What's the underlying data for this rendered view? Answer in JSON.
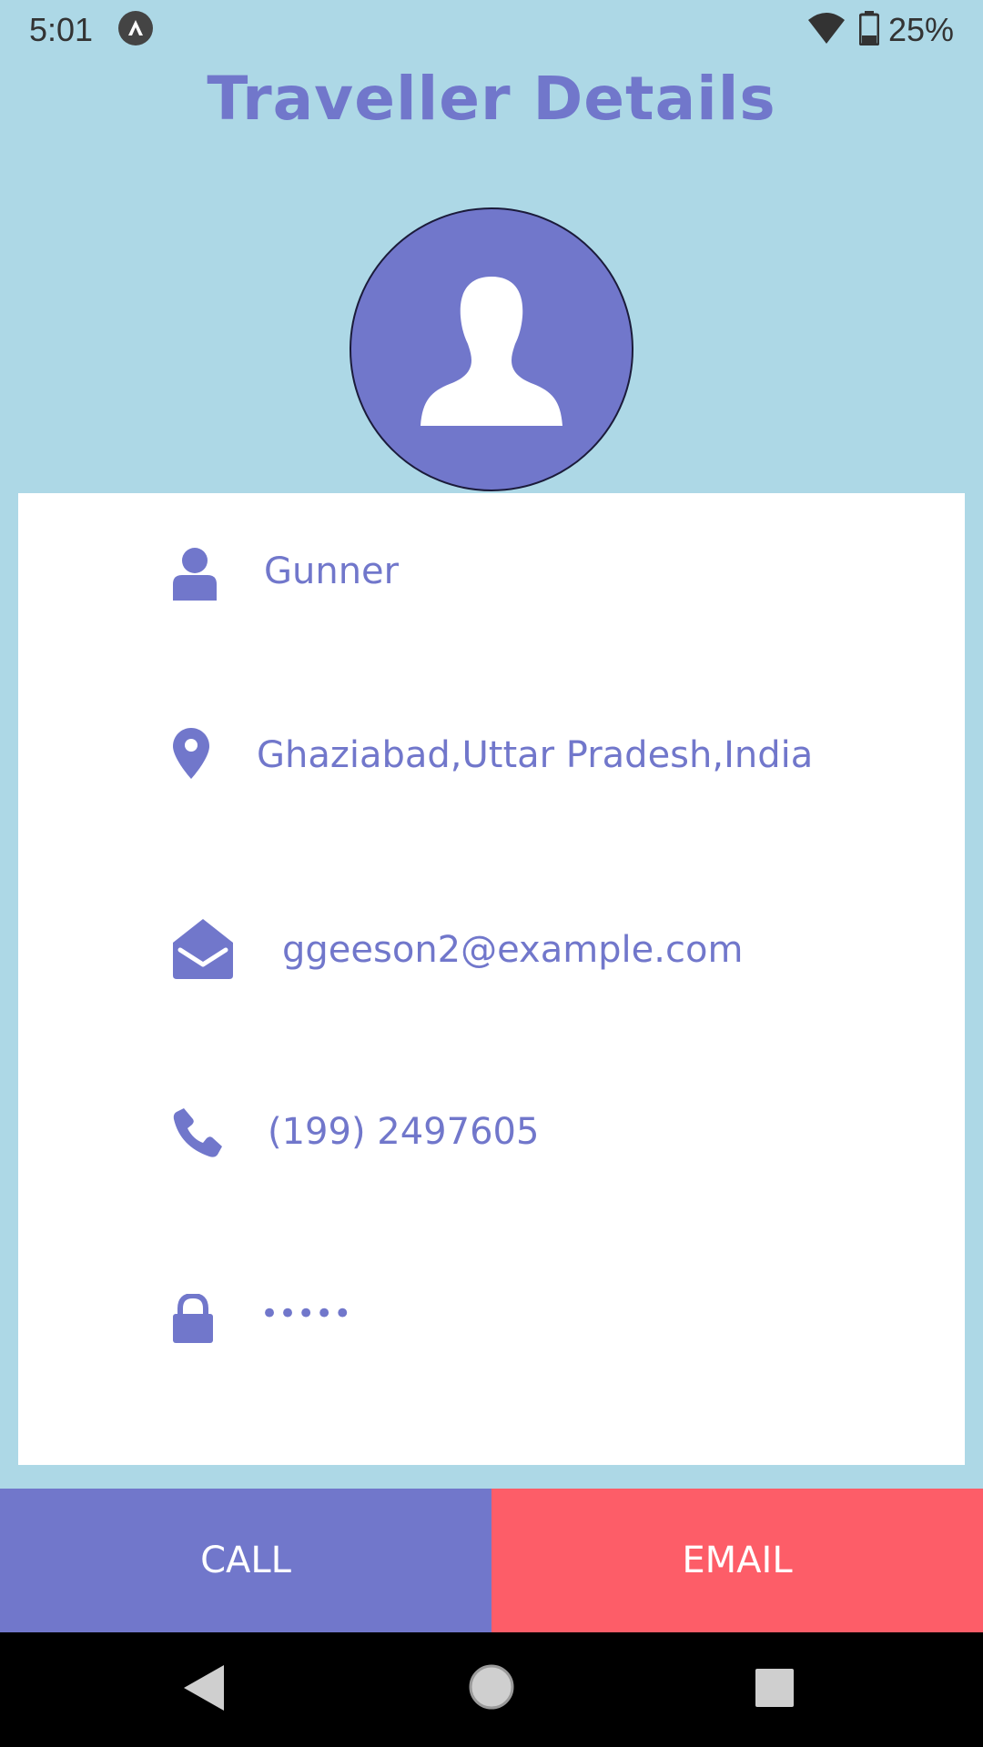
{
  "status_bar": {
    "time": "5:01",
    "battery_percent": "25%",
    "icons": [
      "app-notification-icon",
      "wifi-icon",
      "battery-icon"
    ]
  },
  "title": "Traveller Details",
  "profile": {
    "avatar_icon": "user-silhouette-icon",
    "name": "Gunner",
    "location": "Ghaziabad,Uttar Pradesh,India",
    "email": "ggeeson2@example.com",
    "phone": "(199) 2497605",
    "password_mask": "•••••"
  },
  "actions": {
    "call_label": "CALL",
    "email_label": "EMAIL"
  },
  "colors": {
    "background": "#add8e6",
    "accent": "#7177cb",
    "email_button": "#fd5d68",
    "card": "#ffffff"
  },
  "nav_bar": {
    "icons": [
      "back-icon",
      "home-icon",
      "recents-icon"
    ]
  }
}
